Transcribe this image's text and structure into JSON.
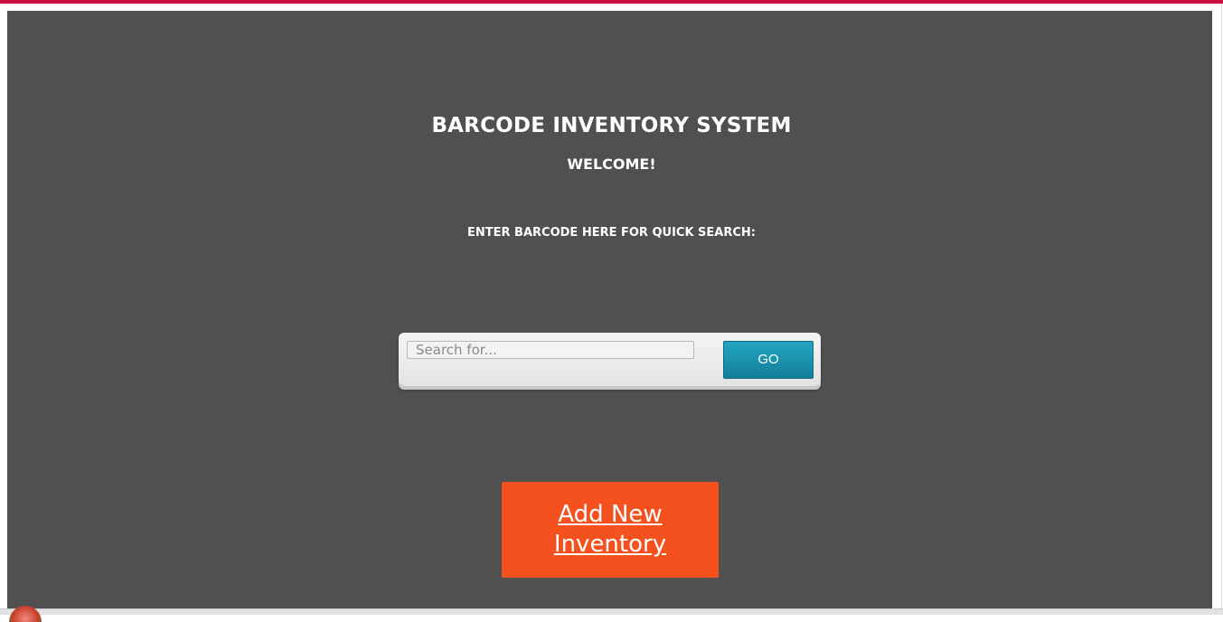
{
  "header": {
    "title": "BARCODE INVENTORY SYSTEM",
    "welcome": "WELCOME!"
  },
  "search": {
    "label": "ENTER BARCODE HERE FOR QUICK SEARCH:",
    "placeholder": "Search for...",
    "value": "",
    "button_label": "GO"
  },
  "actions": {
    "add_inventory_label": "Add New Inventory"
  },
  "colors": {
    "accent_top_bar": "#c8113f",
    "panel_background": "#514f50",
    "go_button": "#1a8fa8",
    "add_button": "#f5511e"
  }
}
